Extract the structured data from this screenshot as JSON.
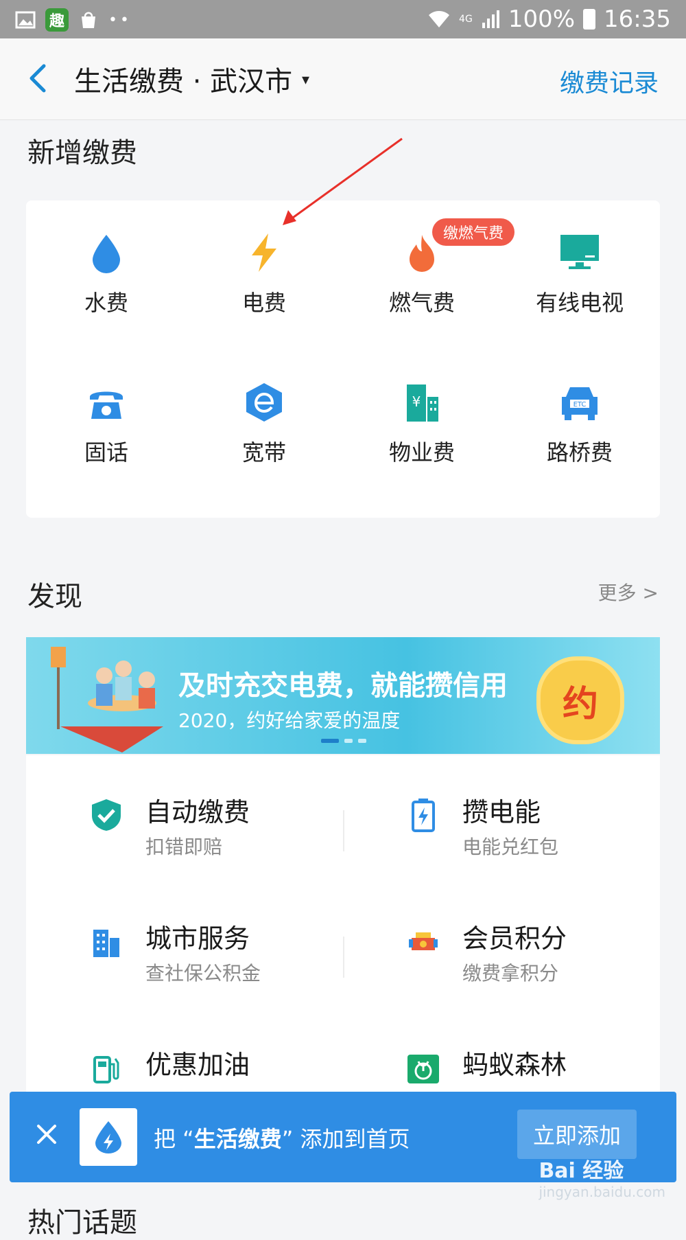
{
  "status_bar": {
    "network": "4G",
    "battery": "100%",
    "time": "16:35",
    "app_badge": "趣"
  },
  "header": {
    "title": "生活缴费 · 武汉市",
    "caret": "▾",
    "record_link": "缴费记录"
  },
  "add_section": {
    "title": "新增缴费",
    "badge": "缴燃气费",
    "items": [
      {
        "label": "水费",
        "icon": "water-drop-icon"
      },
      {
        "label": "电费",
        "icon": "lightning-icon"
      },
      {
        "label": "燃气费",
        "icon": "flame-icon"
      },
      {
        "label": "有线电视",
        "icon": "tv-icon"
      },
      {
        "label": "固话",
        "icon": "telephone-icon"
      },
      {
        "label": "宽带",
        "icon": "broadband-icon"
      },
      {
        "label": "物业费",
        "icon": "building-icon"
      },
      {
        "label": "路桥费",
        "icon": "car-etc-icon"
      }
    ]
  },
  "discover": {
    "title": "发现",
    "more": "更多 >",
    "banner": {
      "title": "及时充交电费，就能攒信用",
      "subtitle": "2020，约好给家爱的温度",
      "seal": "约",
      "car_badge": "ETC"
    },
    "items": [
      {
        "title": "自动缴费",
        "subtitle": "扣错即赔",
        "icon": "shield-check-icon"
      },
      {
        "title": "攒电能",
        "subtitle": "电能兑红包",
        "icon": "battery-icon"
      },
      {
        "title": "城市服务",
        "subtitle": "查社保公积金",
        "icon": "city-building-icon"
      },
      {
        "title": "会员积分",
        "subtitle": "缴费拿积分",
        "icon": "gift-icon"
      },
      {
        "title": "优惠加油",
        "subtitle": "",
        "icon": "fuel-pump-icon"
      },
      {
        "title": "蚂蚁森林",
        "subtitle": "",
        "icon": "sprout-icon"
      }
    ]
  },
  "add_bar": {
    "prefix": "把 “",
    "app_name": "生活缴费",
    "suffix": "” 添加到首页",
    "button": "立即添加"
  },
  "hot_topics": {
    "title": "热门话题"
  },
  "watermark": {
    "brand": "Bai 经验",
    "url": "jingyan.baidu.com"
  },
  "colors": {
    "accent": "#2f8de4",
    "link": "#1a8ad4",
    "badge": "#f05a4a"
  }
}
